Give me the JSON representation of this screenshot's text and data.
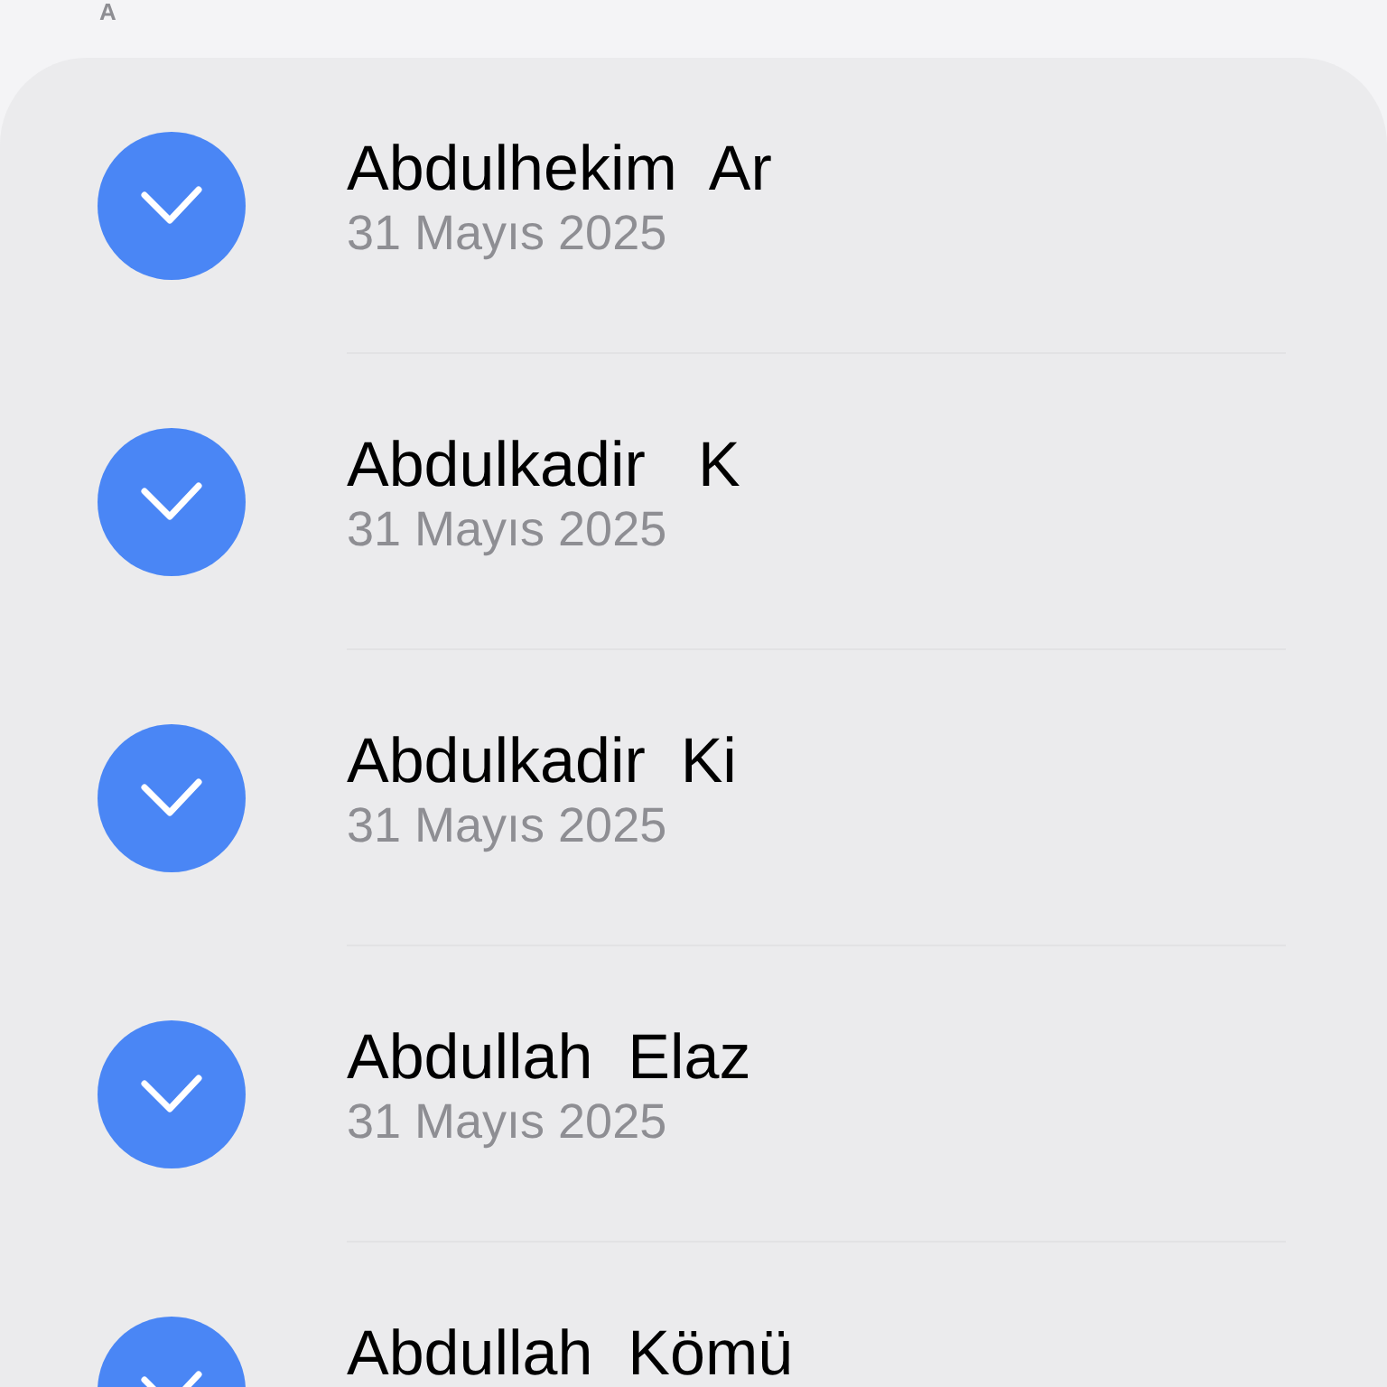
{
  "section_header": "A",
  "contacts": [
    {
      "name": "Abdulhekim  Ar",
      "date": "31 Mayıs 2025",
      "checked": true
    },
    {
      "name": "Abdulkadir   K",
      "date": "31 Mayıs 2025",
      "checked": true
    },
    {
      "name": "Abdulkadir  Ki",
      "date": "31 Mayıs 2025",
      "checked": true
    },
    {
      "name": "Abdullah  Elaz",
      "date": "31 Mayıs 2025",
      "checked": true
    },
    {
      "name": "Abdullah  Kömü",
      "checked": true
    }
  ]
}
